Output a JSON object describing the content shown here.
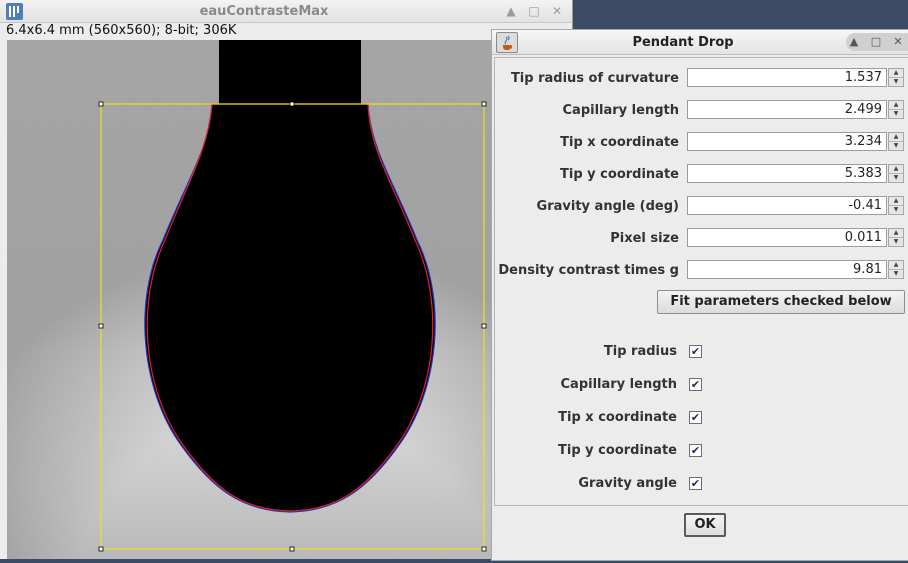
{
  "image_window": {
    "title": "eauContrasteMax",
    "info": "6.4x6.4 mm (560x560); 8-bit; 306K",
    "controls": {
      "minimize": "▲",
      "maximize": "□",
      "close": "✕"
    }
  },
  "dialog": {
    "title": "Pendant Drop",
    "controls": {
      "minimize": "▲",
      "maximize": "□",
      "close": "✕"
    },
    "fields": [
      {
        "label": "Tip radius of curvature",
        "value": "1.537"
      },
      {
        "label": "Capillary length",
        "value": "2.499"
      },
      {
        "label": "Tip x coordinate",
        "value": "3.234"
      },
      {
        "label": "Tip y coordinate",
        "value": "5.383"
      },
      {
        "label": "Gravity angle (deg)",
        "value": "-0.41"
      },
      {
        "label": "Pixel size",
        "value": "0.011"
      },
      {
        "label": "Density contrast times g",
        "value": "9.81"
      }
    ],
    "fit_button": "Fit parameters checked below",
    "checkboxes": [
      {
        "label": "Tip radius",
        "checked": true
      },
      {
        "label": "Capillary length",
        "checked": true
      },
      {
        "label": "Tip x coordinate",
        "checked": true
      },
      {
        "label": "Tip y coordinate",
        "checked": true
      },
      {
        "label": "Gravity angle",
        "checked": true
      }
    ],
    "check_mark": "✔",
    "ok_button": "OK"
  },
  "colors": {
    "selection": "#f0e020",
    "fit_curve": "#e0202a",
    "edge_curve": "#2030c0",
    "drop": "#000000"
  },
  "icons": [
    "imagej-icon",
    "java-icon",
    "spinner-up-icon",
    "spinner-down-icon"
  ]
}
